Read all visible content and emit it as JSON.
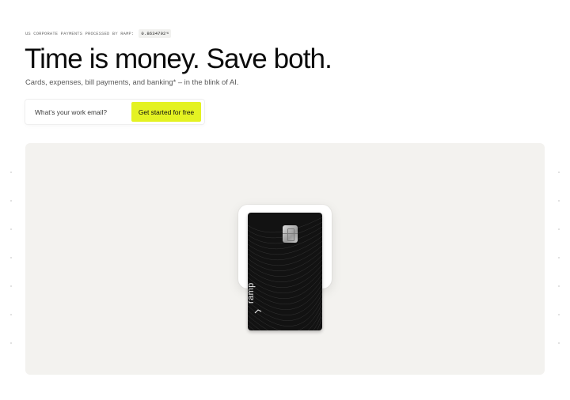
{
  "eyebrow": {
    "label": "US CORPORATE PAYMENTS PROCESSED BY RAMP:",
    "counter_value": "0.8634792",
    "counter_unit": "%"
  },
  "hero": {
    "headline": "Time is money. Save both.",
    "subhead": "Cards, expenses, bill payments, and banking* – in the blink of AI."
  },
  "signup": {
    "email_placeholder": "What’s your work email?",
    "cta_label": "Get started for free"
  },
  "card": {
    "brand_label": "ramp"
  },
  "colors": {
    "accent": "#e4f222",
    "panel": "#f3f2ef",
    "card": "#121212"
  },
  "icons": {
    "card_chip": "chip-icon",
    "brand_mark": "ramp-logo-icon"
  }
}
